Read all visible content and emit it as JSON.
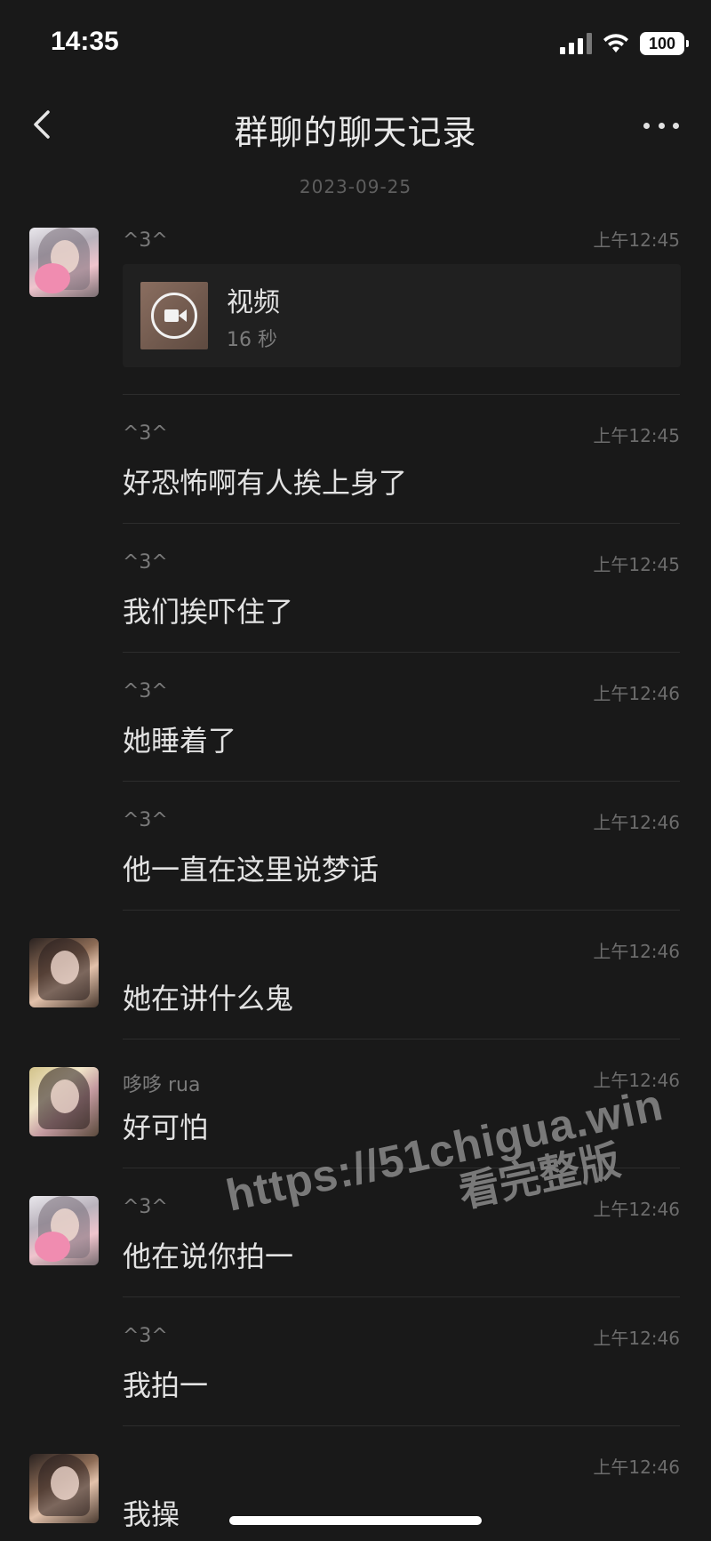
{
  "status_bar": {
    "time": "14:35",
    "battery": "100"
  },
  "nav": {
    "title": "群聊的聊天记录"
  },
  "date": "2023-09-25",
  "video": {
    "title": "视频",
    "duration": "16 秒"
  },
  "messages": [
    {
      "sender": "^3^",
      "time": "上午12:45",
      "text": ""
    },
    {
      "sender": "^3^",
      "time": "上午12:45",
      "text": "好恐怖啊有人挨上身了"
    },
    {
      "sender": "^3^",
      "time": "上午12:45",
      "text": "我们挨吓住了"
    },
    {
      "sender": "^3^",
      "time": "上午12:46",
      "text": "她睡着了"
    },
    {
      "sender": "^3^",
      "time": "上午12:46",
      "text": "他一直在这里说梦话"
    },
    {
      "sender": "",
      "time": "上午12:46",
      "text": "她在讲什么鬼"
    },
    {
      "sender": "哆哆 rua",
      "time": "上午12:46",
      "text": "好可怕"
    },
    {
      "sender": "^3^",
      "time": "上午12:46",
      "text": "他在说你拍一"
    },
    {
      "sender": "^3^",
      "time": "上午12:46",
      "text": "我拍一"
    },
    {
      "sender": "",
      "time": "上午12:46",
      "text": "我操"
    }
  ],
  "watermark": {
    "line1": "https://51chigua.win",
    "line2": "看完整版"
  }
}
